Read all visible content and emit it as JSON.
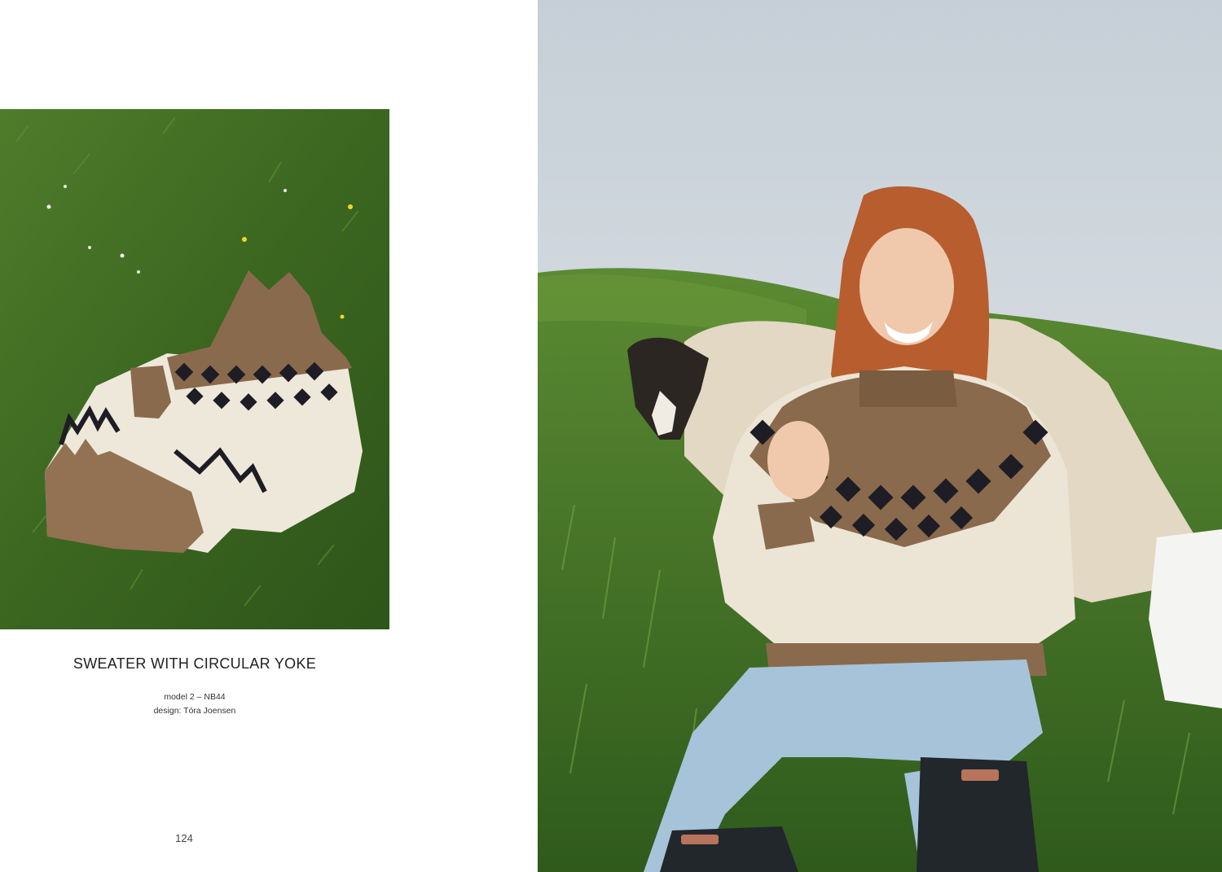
{
  "spread": {
    "left_page": {
      "title": "SWEATER WITH CIRCULAR YOKE",
      "model": "model 2 – NB44",
      "designer": "design: Tóra Joensen",
      "page_number": "124"
    }
  },
  "colors": {
    "grass": "#3f6a24",
    "sky": "#d8dde2",
    "wool_white": "#efe9dc",
    "wool_brown": "#8a6a4c",
    "pattern_dark": "#1e1d25"
  }
}
